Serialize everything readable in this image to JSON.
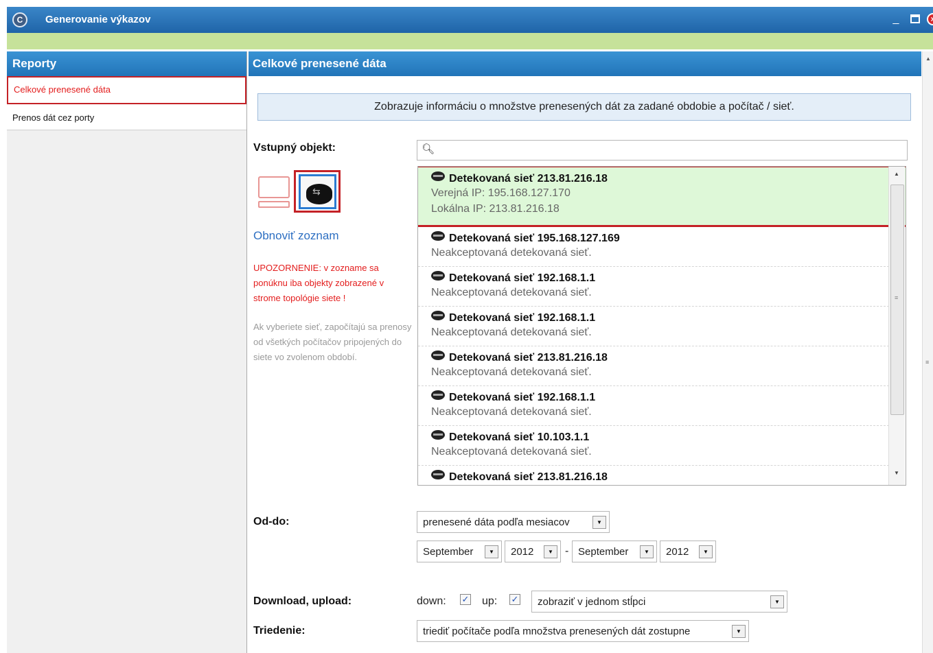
{
  "window": {
    "title": "Generovanie výkazov",
    "icon": "C"
  },
  "sidebar": {
    "header": "Reporty",
    "items": [
      {
        "label": "Celkové prenesené dáta",
        "active": true
      },
      {
        "label": "Prenos dát cez porty",
        "active": false
      }
    ]
  },
  "main": {
    "header": "Celkové prenesené dáta",
    "info": "Zobrazuje informáciu o množstve prenesených dát za zadané obdobie a počítač / sieť.",
    "input_label": "Vstupný objekt:",
    "search_placeholder": "",
    "refresh_link": "Obnoviť zoznam",
    "warning": "UPOZORNENIE: v zozname sa ponúknu iba objekty zobrazené v strome topológie siete !",
    "hint": "Ak vyberiete sieť, započítajú sa prenosy od všetkých počítačov pripojených do siete vo zvolenom období.",
    "list": [
      {
        "name": "Detekovaná sieť 213.81.216.18",
        "sub1": "Verejná IP: 195.168.127.170",
        "sub2": "Lokálna IP: 213.81.216.18",
        "selected": true
      },
      {
        "name": "Detekovaná sieť 195.168.127.169",
        "sub1": "Neakceptovaná detekovaná sieť.",
        "selected": false
      },
      {
        "name": "Detekovaná sieť 192.168.1.1",
        "sub1": "Neakceptovaná detekovaná sieť.",
        "selected": false
      },
      {
        "name": "Detekovaná sieť 192.168.1.1",
        "sub1": "Neakceptovaná detekovaná sieť.",
        "selected": false
      },
      {
        "name": "Detekovaná sieť 213.81.216.18",
        "sub1": "Neakceptovaná detekovaná sieť.",
        "selected": false
      },
      {
        "name": "Detekovaná sieť 192.168.1.1",
        "sub1": "Neakceptovaná detekovaná sieť.",
        "selected": false
      },
      {
        "name": "Detekovaná sieť 10.103.1.1",
        "sub1": "Neakceptovaná detekovaná sieť.",
        "selected": false
      },
      {
        "name": "Detekovaná sieť 213.81.216.18",
        "sub1": "",
        "selected": false
      }
    ],
    "period_label": "Od-do:",
    "period_mode": "prenesené dáta podľa mesiacov",
    "from_month": "September",
    "from_year": "2012",
    "range_separator": "-",
    "to_month": "September",
    "to_year": "2012",
    "traffic_label": "Download, upload:",
    "down_label": "down:",
    "down_checked": true,
    "up_label": "up:",
    "up_checked": true,
    "traffic_mode": "zobraziť v jednom stĺpci",
    "sort_label": "Triedenie:",
    "sort_mode": "triediť počítače podľa množstva prenesených dát zostupne"
  },
  "colors": {
    "accent": "#2174b8",
    "highlight_border": "#c42126",
    "selection": "#def8d8",
    "warning": "#e31c1c",
    "link": "#2d6fc2"
  }
}
